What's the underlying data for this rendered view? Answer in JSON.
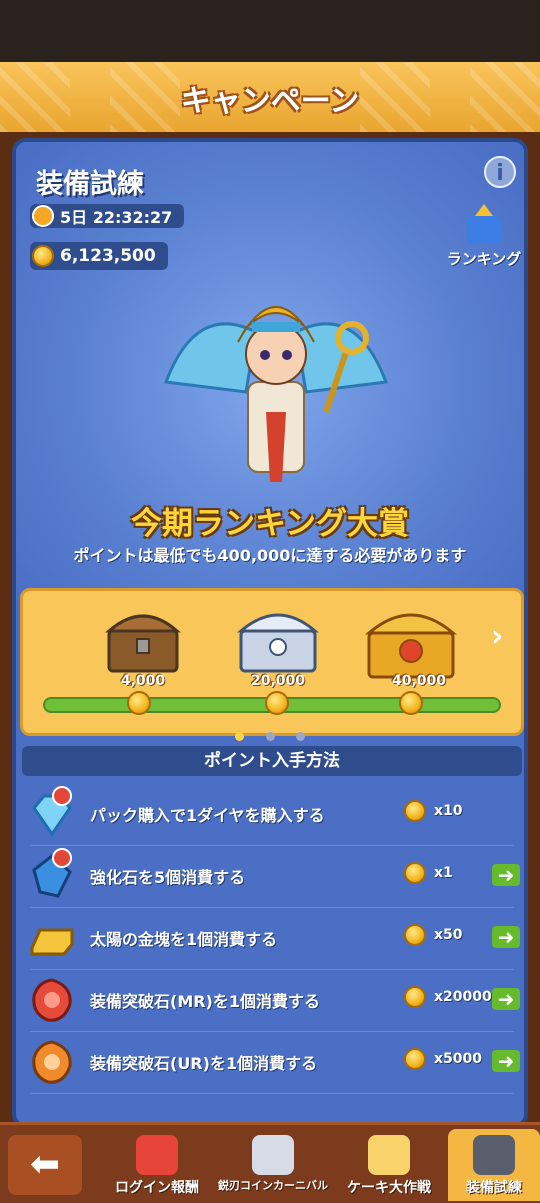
{
  "header": {
    "title": "キャンペーン"
  },
  "event": {
    "title": "装備試練",
    "timer": "5日 22:32:27",
    "points": "6,123,500",
    "ranking_label": "ランキング"
  },
  "award": {
    "title": "今期ランキング大賞",
    "subtitle": "ポイントは最低でも400,000に達する必要があります"
  },
  "rewards": {
    "milestones": [
      "4,000",
      "20,000",
      "40,000"
    ],
    "page_dots": {
      "count": 3,
      "active": 0
    }
  },
  "how_to": {
    "heading": "ポイント入手方法",
    "rows": [
      {
        "label": "パック購入で1ダイヤを購入する",
        "qty": "x10",
        "icon": "diamond-icon",
        "has_go": false
      },
      {
        "label": "強化石を5個消費する",
        "qty": "x1",
        "icon": "enhance-stone-icon",
        "has_go": true
      },
      {
        "label": "太陽の金塊を1個消費する",
        "qty": "x50",
        "icon": "gold-bar-icon",
        "has_go": true
      },
      {
        "label": "装備突破石(MR)を1個消費する",
        "qty": "x20000",
        "icon": "mr-stone-icon",
        "has_go": true
      },
      {
        "label": "装備突破石(UR)を1個消費する",
        "qty": "x5000",
        "icon": "ur-stone-icon",
        "has_go": true
      }
    ]
  },
  "bottom_tabs": [
    {
      "label": "ログイン報酬",
      "icon": "gift-icon",
      "active": false
    },
    {
      "label": "鋭刃コインカーニバル",
      "icon": "sword-icon",
      "active": false
    },
    {
      "label": "ケーキ大作戦",
      "icon": "cake-icon",
      "active": false
    },
    {
      "label": "装備試練",
      "icon": "armor-icon",
      "active": true
    }
  ],
  "colors": {
    "panel": "#4a6fc5",
    "header": "#f9c45b",
    "gold": "#ffd53d",
    "go_button": "#65bb2c"
  }
}
